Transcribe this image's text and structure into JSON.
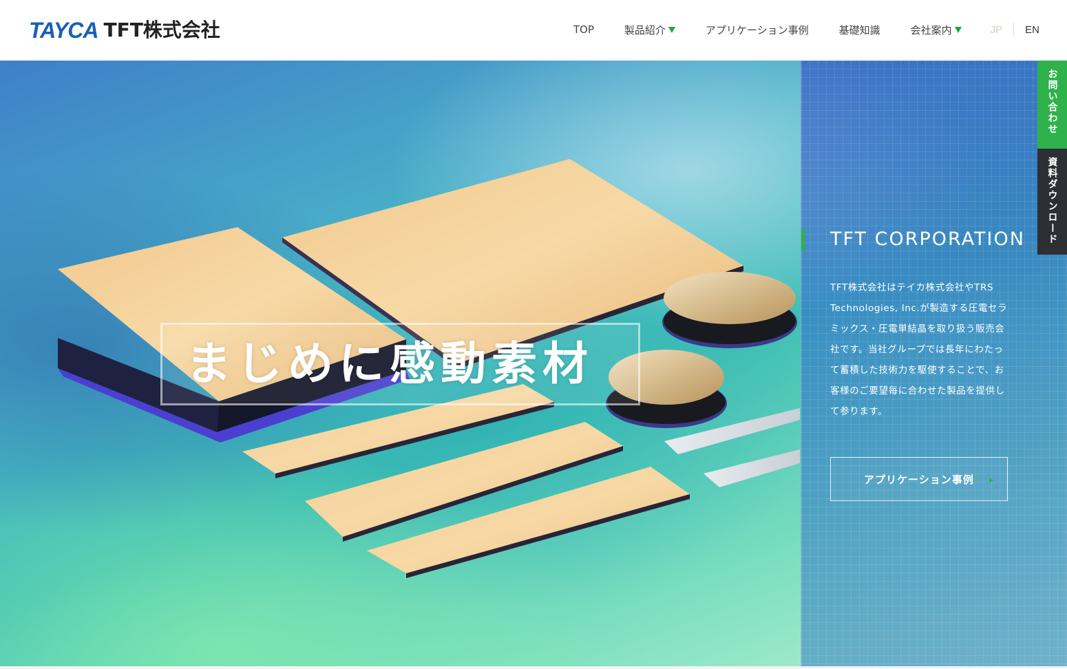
{
  "header": {
    "logo_brand": "TAYCA",
    "logo_company": "TFT株式会社",
    "nav": [
      {
        "label": "TOP",
        "has_dropdown": false
      },
      {
        "label": "製品紹介",
        "has_dropdown": true
      },
      {
        "label": "アプリケーション事例",
        "has_dropdown": false
      },
      {
        "label": "基礎知識",
        "has_dropdown": false
      },
      {
        "label": "会社案内",
        "has_dropdown": true
      }
    ],
    "lang_jp": "JP",
    "lang_en": "EN"
  },
  "hero": {
    "tagline": "まじめに感動素材"
  },
  "panel": {
    "title": "TFT CORPORATION",
    "description": "TFT株式会社はテイカ株式会社やTRS Technologies, Inc.が製造する圧電セラミックス・圧電単結晶を取り扱う販売会社です。当社グループでは長年にわたって蓄積した技術力を駆使することで、お客様のご要望毎に合わせた製品を提供して参ります。",
    "cta_label": "アプリケーション事例"
  },
  "side_tabs": {
    "contact": "お問い合わせ",
    "download": "資料ダウンロード"
  },
  "colors": {
    "brand_blue": "#1a5fb4",
    "accent_green": "#2fb24c",
    "dark_tab": "#2c2f33"
  }
}
